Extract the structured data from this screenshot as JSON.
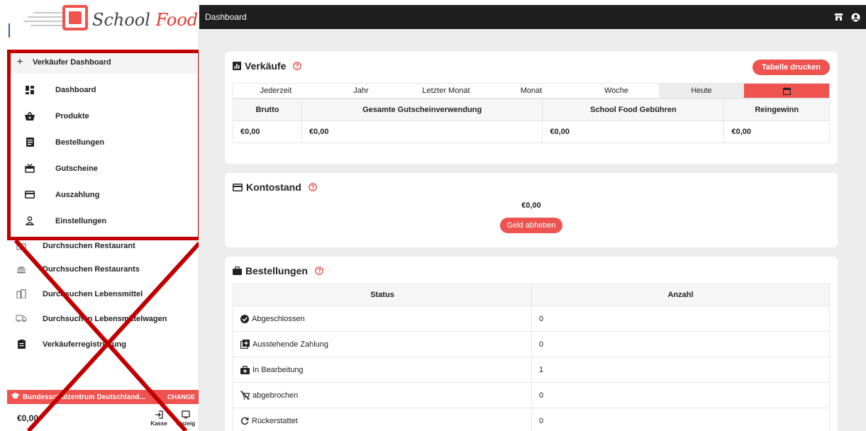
{
  "sidebar": {
    "logo": {
      "text_main": "School",
      "text_accent": "Food"
    },
    "menu_header": "Verkäufer Dashboard",
    "menu_items": [
      {
        "label": "Dashboard",
        "icon": "dashboard-icon"
      },
      {
        "label": "Produkte",
        "icon": "basket-icon"
      },
      {
        "label": "Bestellungen",
        "icon": "list-icon"
      },
      {
        "label": "Gutscheine",
        "icon": "coupon-icon"
      },
      {
        "label": "Auszahlung",
        "icon": "card-icon"
      },
      {
        "label": "Einstellungen",
        "icon": "person-icon"
      }
    ],
    "hidden_items": [
      {
        "label": "Durchsuchen Restaurant",
        "icon": "store-icon"
      },
      {
        "label": "Durchsuchen Restaurants",
        "icon": "burger-icon"
      },
      {
        "label": "Durchsuchen Lebensmittel",
        "icon": "building-icon"
      },
      {
        "label": "Durchsuchen Lebensmittelwagen",
        "icon": "truck-icon"
      },
      {
        "label": "Verkäuferregistrierung",
        "icon": "clipboard-icon"
      }
    ],
    "school": {
      "name": "Bundesschulzentrum Deutschland...",
      "change": "CHANGE"
    },
    "balance": "€0,00",
    "bottom_buttons": [
      {
        "label": "Kasse"
      },
      {
        "label": "Anzeig"
      }
    ]
  },
  "topbar": {
    "title": "Dashboard"
  },
  "sales": {
    "title": "Verkäufe",
    "print_button": "Tabelle drucken",
    "tabs": [
      "Jederzeit",
      "Jahr",
      "Letzter Monat",
      "Monat",
      "Woche",
      "Heute"
    ],
    "active_tab": "Heute",
    "headers": [
      "Brutto",
      "Gesamte Gutscheinverwendung",
      "School Food Gebühren",
      "Reingewinn"
    ],
    "values": [
      "€0,00",
      "€0,00",
      "€0,00",
      "€0,00"
    ]
  },
  "account": {
    "title": "Kontostand",
    "balance": "€0,00",
    "button": "Geld abheben"
  },
  "orders": {
    "title": "Bestellungen",
    "headers": [
      "Status",
      "Anzahl"
    ],
    "rows": [
      {
        "status": "Abgeschlossen",
        "count": "0",
        "icon": "check-circle-icon"
      },
      {
        "status": "Ausstehende Zahlung",
        "count": "0",
        "icon": "add-box-icon"
      },
      {
        "status": "In Bearbeitung",
        "count": "1",
        "icon": "briefcase-plus-icon"
      },
      {
        "status": "abgebrochen",
        "count": "0",
        "icon": "cart-off-icon"
      },
      {
        "status": "Rückerstattet",
        "count": "0",
        "icon": "refresh-icon"
      }
    ]
  },
  "colors": {
    "accent": "#ef5350",
    "annotation": "#c00000",
    "topbar": "#1f1f1f"
  }
}
